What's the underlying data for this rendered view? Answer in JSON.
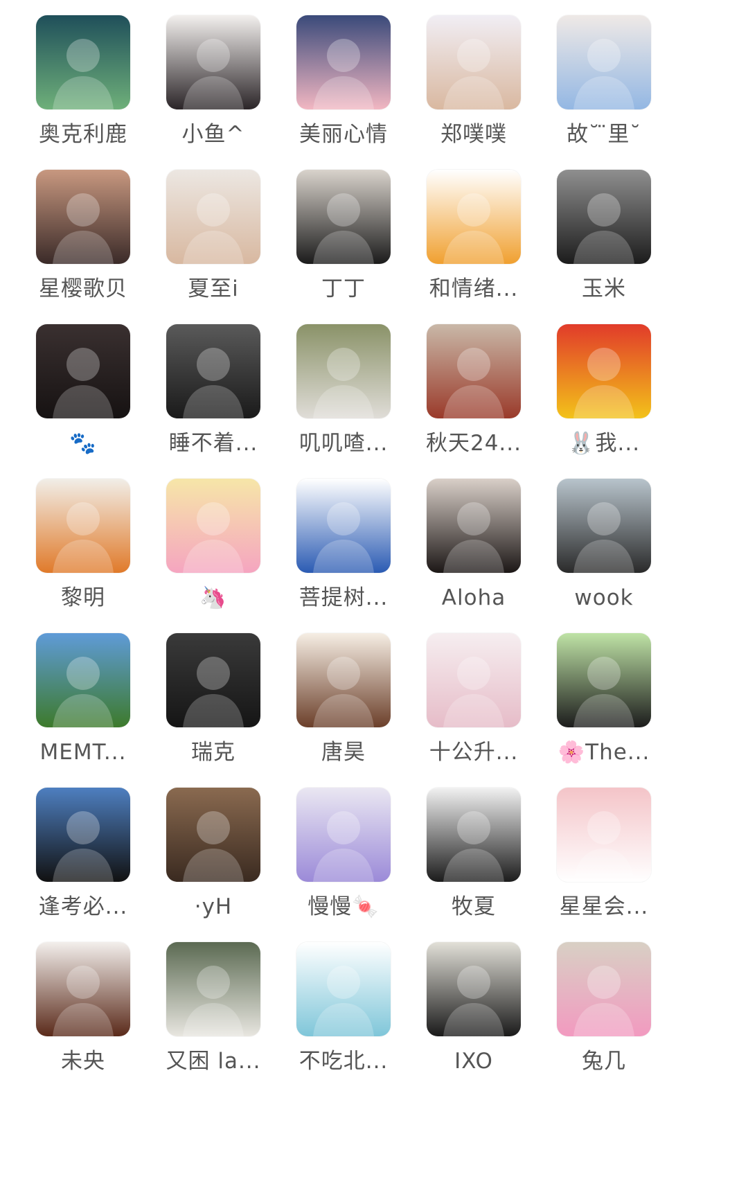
{
  "contacts": [
    {
      "name": "奥克利鹿",
      "bg": [
        "#1f4f5a",
        "#6fb07a"
      ],
      "icon": "person-avatar-icon"
    },
    {
      "name": "小鱼^",
      "bg": [
        "#f3f0ee",
        "#2b2528"
      ],
      "icon": "anime-girl-avatar-icon"
    },
    {
      "name": "美丽心情",
      "bg": [
        "#3a4a7a",
        "#f2b7c2"
      ],
      "icon": "anime-girl-avatar-icon"
    },
    {
      "name": "郑噗噗",
      "bg": [
        "#f1eef4",
        "#d9b8a0"
      ],
      "icon": "plush-fox-avatar-icon"
    },
    {
      "name": "故˘ ̈里˘",
      "bg": [
        "#efe9e6",
        "#93b7e3"
      ],
      "icon": "illustrated-girl-avatar-icon"
    },
    {
      "name": "星樱歌贝",
      "bg": [
        "#c89880",
        "#3a2a28"
      ],
      "icon": "cat-avatar-icon"
    },
    {
      "name": "夏至i",
      "bg": [
        "#ece7e2",
        "#d8b8a0"
      ],
      "icon": "photo-avatar-icon"
    },
    {
      "name": "丁丁",
      "bg": [
        "#d9d3cc",
        "#1b1b1b"
      ],
      "icon": "person-avatar-icon"
    },
    {
      "name": "和情绪...",
      "bg": [
        "#ffffff",
        "#f0a030"
      ],
      "icon": "cartoon-cat-avatar-icon"
    },
    {
      "name": "玉米",
      "bg": [
        "#8f8f8f",
        "#1c1c1c"
      ],
      "icon": "people-avatar-icon"
    },
    {
      "name": "🐾",
      "bg": [
        "#3a3030",
        "#161212"
      ],
      "icon": "person-avatar-icon"
    },
    {
      "name": "睡不着...",
      "bg": [
        "#5a5a5a",
        "#1a1a1a"
      ],
      "icon": "person-avatar-icon"
    },
    {
      "name": "叽叽喳...",
      "bg": [
        "#8a9268",
        "#e0ddd8"
      ],
      "icon": "person-avatar-icon"
    },
    {
      "name": "秋天24...",
      "bg": [
        "#c9b8a8",
        "#9a3a2a"
      ],
      "icon": "person-avatar-icon"
    },
    {
      "name": "🐰我...",
      "bg": [
        "#e13b2a",
        "#f3c21a"
      ],
      "icon": "poster-avatar-icon"
    },
    {
      "name": "黎明",
      "bg": [
        "#f1eee8",
        "#e07a2a"
      ],
      "icon": "anime-girl-avatar-icon"
    },
    {
      "name": "🦄",
      "bg": [
        "#f6e6a8",
        "#f5a5c0"
      ],
      "icon": "cartoon-star-avatar-icon"
    },
    {
      "name": "菩提树...",
      "bg": [
        "#ffffff",
        "#2b5bb3"
      ],
      "icon": "badge-avatar-icon"
    },
    {
      "name": "Aloha",
      "bg": [
        "#d9cfc8",
        "#1c1716"
      ],
      "icon": "person-avatar-icon"
    },
    {
      "name": "wook",
      "bg": [
        "#b8c4cc",
        "#2a2a2a"
      ],
      "icon": "person-avatar-icon"
    },
    {
      "name": "MEMT...",
      "bg": [
        "#5f9bd8",
        "#3d7a2b"
      ],
      "icon": "landscape-avatar-icon"
    },
    {
      "name": "瑞克",
      "bg": [
        "#3a3a3a",
        "#151515"
      ],
      "icon": "people-avatar-icon"
    },
    {
      "name": "唐昊",
      "bg": [
        "#f6eee4",
        "#6b3f2a"
      ],
      "icon": "anime-girl-avatar-icon"
    },
    {
      "name": "十公升...",
      "bg": [
        "#f6eef0",
        "#e6bcc8"
      ],
      "icon": "anime-avatar-icon"
    },
    {
      "name": "🌸The...",
      "bg": [
        "#bfe3a6",
        "#1c1c1c"
      ],
      "icon": "cartoon-girl-avatar-icon"
    },
    {
      "name": "逢考必...",
      "bg": [
        "#4e7fc0",
        "#111111"
      ],
      "icon": "person-avatar-icon"
    },
    {
      "name": "·yH",
      "bg": [
        "#8a6a50",
        "#3a2a20"
      ],
      "icon": "person-avatar-icon"
    },
    {
      "name": "慢慢🍬",
      "bg": [
        "#eae7f2",
        "#9b8ad8"
      ],
      "icon": "person-avatar-icon"
    },
    {
      "name": "牧夏",
      "bg": [
        "#f2f2f2",
        "#1c1c1c"
      ],
      "icon": "person-avatar-icon"
    },
    {
      "name": "星星会...",
      "bg": [
        "#f4c4c8",
        "#ffffff"
      ],
      "icon": "cartoon-bear-avatar-icon"
    },
    {
      "name": "未央",
      "bg": [
        "#f3efec",
        "#5a2a1a"
      ],
      "icon": "person-avatar-icon"
    },
    {
      "name": "又困 la...",
      "bg": [
        "#5b6a52",
        "#e8e6e0"
      ],
      "icon": "person-avatar-icon"
    },
    {
      "name": "不吃北...",
      "bg": [
        "#ffffff",
        "#7fc6d9"
      ],
      "icon": "cartoon-duck-avatar-icon"
    },
    {
      "name": "IXO",
      "bg": [
        "#e2e0d8",
        "#1a1a1a"
      ],
      "icon": "person-avatar-icon"
    },
    {
      "name": "兔几",
      "bg": [
        "#d8d0c4",
        "#f29ac0"
      ],
      "icon": "anime-avatar-icon"
    }
  ]
}
